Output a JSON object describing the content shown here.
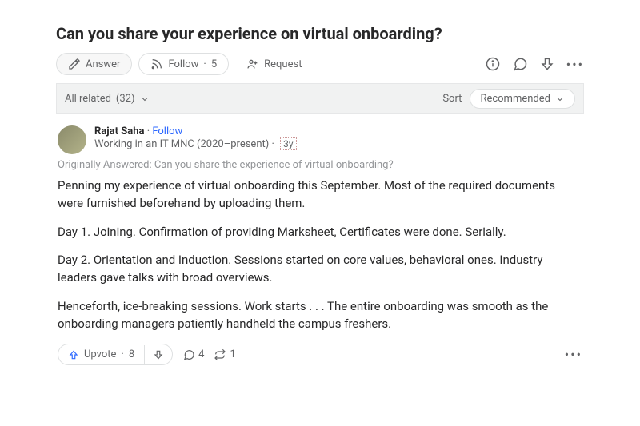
{
  "question": {
    "title": "Can you share your experience on virtual onboarding?"
  },
  "actions": {
    "answer": "Answer",
    "follow": "Follow",
    "follow_count": "5",
    "request": "Request"
  },
  "sort": {
    "all_related_label": "All related",
    "all_related_count": "(32)",
    "sort_label": "Sort",
    "sort_value": "Recommended"
  },
  "answer": {
    "author_name": "Rajat Saha",
    "follow": "Follow",
    "credential": "Working in an IT MNC (2020–present)",
    "time": "3y",
    "originally": "Originally Answered: Can you share the experience of virtual onboarding?",
    "paragraphs": [
      "Penning my experience of virtual onboarding this September. Most of the required documents were furnished beforehand by uploading them.",
      "Day 1. Joining. Confirmation of providing Marksheet, Certificates were done. Serially.",
      "Day 2. Orientation and Induction. Sessions started on core values, behavioral ones. Industry leaders gave talks with broad overviews.",
      "Henceforth, ice-breaking sessions. Work starts . . . The entire onboarding was smooth as the onboarding managers patiently handheld the campus freshers."
    ]
  },
  "footer": {
    "upvote_label": "Upvote",
    "upvote_count": "8",
    "comment_count": "4",
    "share_count": "1"
  }
}
